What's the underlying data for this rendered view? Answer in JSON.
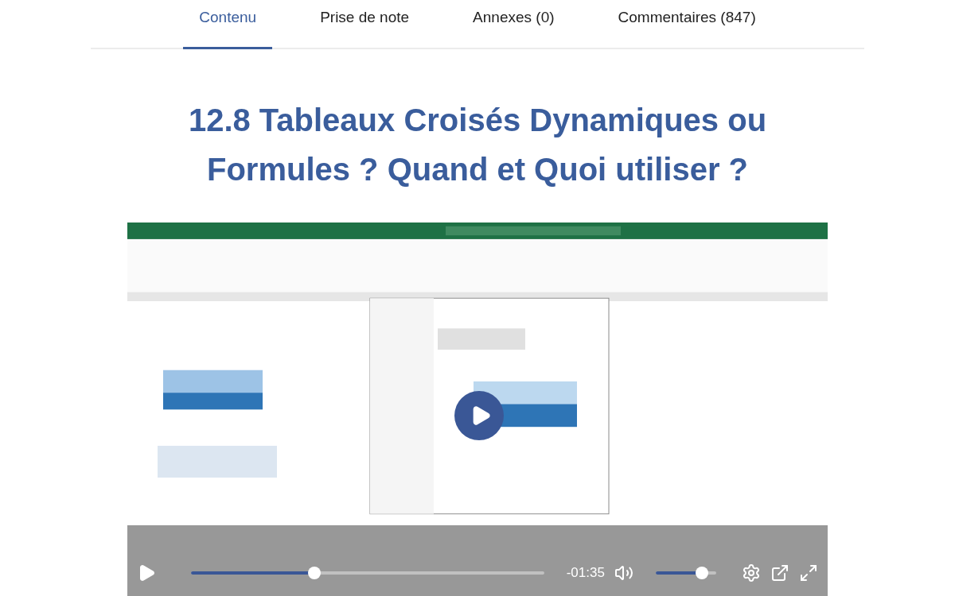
{
  "tabs": [
    {
      "label": "Contenu",
      "selected": true
    },
    {
      "label": "Prise de note",
      "selected": false
    },
    {
      "label": "Annexes (0)",
      "selected": false
    },
    {
      "label": "Commentaires (847)",
      "selected": false
    }
  ],
  "title": "12.8 Tableaux Croisés Dynamiques ou Formules ? Quand et Quoi utiliser ?",
  "video": {
    "progress": {
      "level": 0.35
    },
    "time": "-01:35",
    "volume": {
      "level": 0.77
    }
  }
}
